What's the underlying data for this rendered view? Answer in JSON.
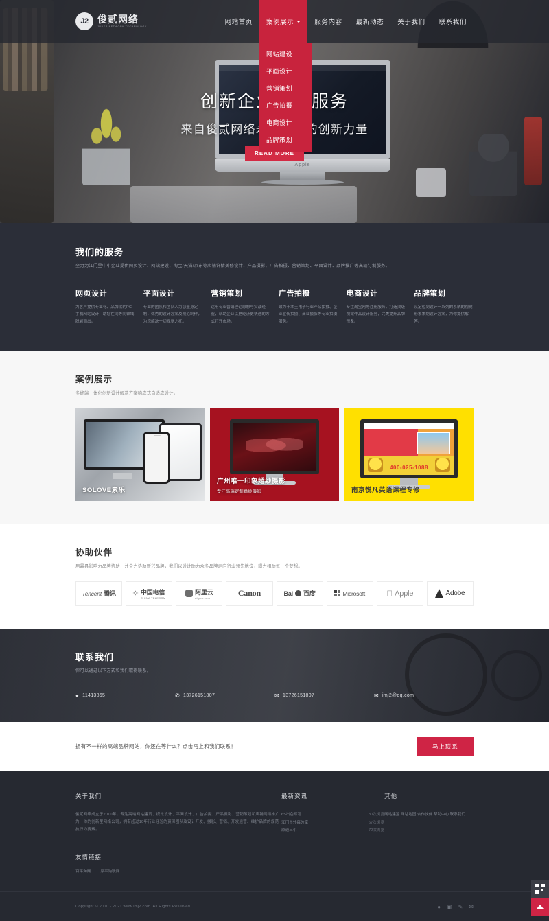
{
  "header": {
    "logo_mark": "J2",
    "logo_cn": "俊贰网络",
    "logo_en": "JUNER NETWORK TECHNOLOGY",
    "nav": [
      {
        "label": "网站首页",
        "active": false
      },
      {
        "label": "案例展示",
        "active": true,
        "caret_icon": "chevron-down-icon"
      },
      {
        "label": "服务内容",
        "active": false
      },
      {
        "label": "最新动态",
        "active": false
      },
      {
        "label": "关于我们",
        "active": false
      },
      {
        "label": "联系我们",
        "active": false
      }
    ],
    "dropdown": [
      {
        "label": "网站建设"
      },
      {
        "label": "平面设计"
      },
      {
        "label": "营销策划"
      },
      {
        "label": "广告拍摄"
      },
      {
        "label": "电商设计"
      },
      {
        "label": "品牌策划"
      }
    ]
  },
  "hero": {
    "title": "创新企业定制服务",
    "subtitle": "来自俊贰网络永不畏惧的创新力量",
    "button": "READ MORE",
    "imac_brand": "Apple"
  },
  "services": {
    "title": "我们的服务",
    "subtitle": "全力为江门里中小企业提供网页设计、网站建设、淘宝/天猫/京东等店铺详情美修设计、产品摄影、广告拍摄、营销策划、平面设计、品牌推广等高端订制服务。",
    "items": [
      {
        "title": "网页设计",
        "desc": "为客户提供专业化、品牌化的PC手机网站设计，助您在同等同领域脱颖而出。"
      },
      {
        "title": "平面设计",
        "desc": "专业的团队和团队人为您量身定制，优秀的设计方案及规范制作，为您解决一切视觉之扰。"
      },
      {
        "title": "营销策划",
        "desc": "运用专业营销理论思想与实战经验，帮助企业以更经济更快速的方式打开市场。"
      },
      {
        "title": "广告拍摄",
        "desc": "致力于本土电子行业产品拍摄、企业宣传拍摄、商业摄影等专业拍摄服务。"
      },
      {
        "title": "电商设计",
        "desc": "专注淘宝网等注册服务，打造顶级视觉作品设计服务，完美提升品牌形象。"
      },
      {
        "title": "品牌策划",
        "desc": "从定位到设计一系列的系统的视觉形象策划设计方案，为你提供解答。"
      }
    ]
  },
  "cases": {
    "title": "案例展示",
    "subtitle": "多终端一体化创新设计解决方案响应式自适应设计。",
    "items": [
      {
        "title": "SOLOVE素乐",
        "subtitle": "",
        "theme": "light"
      },
      {
        "title": "广州唯一印象婚纱摄影",
        "subtitle": "专注高端定制婚纱摄影",
        "theme": "dark"
      },
      {
        "title": "南京悦凡英语课程专修",
        "subtitle": "",
        "theme": "yellow",
        "phone": "400-025-1088"
      }
    ]
  },
  "partners": {
    "title": "协助伙伴",
    "subtitle": "用最具影响力品牌协助，并全力协助新兴品牌，我们以设计助力众多品牌走向行业领先地位，竭力相助每一个梦想。",
    "logos": [
      {
        "name": "Tencent",
        "cn": "腾讯",
        "icon": ""
      },
      {
        "name": "中国电信",
        "cn": "",
        "small": "CHINA TELECOM",
        "icon": "telecom-icon"
      },
      {
        "name": "阿里云",
        "cn": "",
        "small": "aliyun.com",
        "icon": "aliyun-icon"
      },
      {
        "name": "Canon",
        "cn": "",
        "icon": ""
      },
      {
        "name": "Bai",
        "cn": "百度",
        "icon": "baidu-icon"
      },
      {
        "name": "Microsoft",
        "cn": "",
        "icon": "microsoft-icon"
      },
      {
        "name": "Apple",
        "cn": "",
        "icon": "apple-icon"
      },
      {
        "name": "Adobe",
        "cn": "",
        "icon": "adobe-icon"
      }
    ]
  },
  "contact": {
    "title": "联系我们",
    "subtitle": "你可以通过以下方式和我们取得联系。",
    "items": [
      {
        "icon": "qq-icon",
        "value": "11413865"
      },
      {
        "icon": "phone-icon",
        "value": "13726151807"
      },
      {
        "icon": "wechat-icon",
        "value": "13726151807"
      },
      {
        "icon": "mail-icon",
        "value": "imj2@qq.com"
      }
    ]
  },
  "cta": {
    "text": "拥有不一样的高端品牌网站，你还在等什么？点击马上和我们联系！",
    "button": "马上联系"
  },
  "footer": {
    "about_title": "关于我们",
    "about_text": "俊贰网络成立于2010年，专注高端网站建设、视觉设计、平面设计、广告拍摄、产品摄影、营销策划和店铺网络推广为一体的创新型网络公司，拥有超过10年行业经验的资深团队及设计开发、摄影、营销、开发运营、维护品牌的规范执行力要素。",
    "news_title": "最新资讯",
    "news": [
      {
        "label": "6S出色写写",
        "meta": "80次浏览"
      },
      {
        "label": "江门市外每分享",
        "meta": "67次浏览"
      },
      {
        "label": "原速三小",
        "meta": "72次浏览"
      }
    ],
    "other_title": "其他",
    "other_links": "网站建置 网站地图 合作伙伴 帮助中心 联系我们",
    "friend_title": "友情链接",
    "friend_links": [
      "百平淘网",
      "原平淘联网"
    ],
    "copyright": "Copyright © 2010 - 2021 www.imj2.com. All Rights Reserved.",
    "social": [
      "qq-icon",
      "weibo-icon",
      "wechat-icon",
      "mail-icon"
    ]
  },
  "widgets": {
    "qr_icon": "qrcode-icon",
    "back_to_top_icon": "arrow-up-icon"
  },
  "colors": {
    "accent": "#cf2445",
    "dark": "#2b2e38",
    "darker": "#262931"
  }
}
